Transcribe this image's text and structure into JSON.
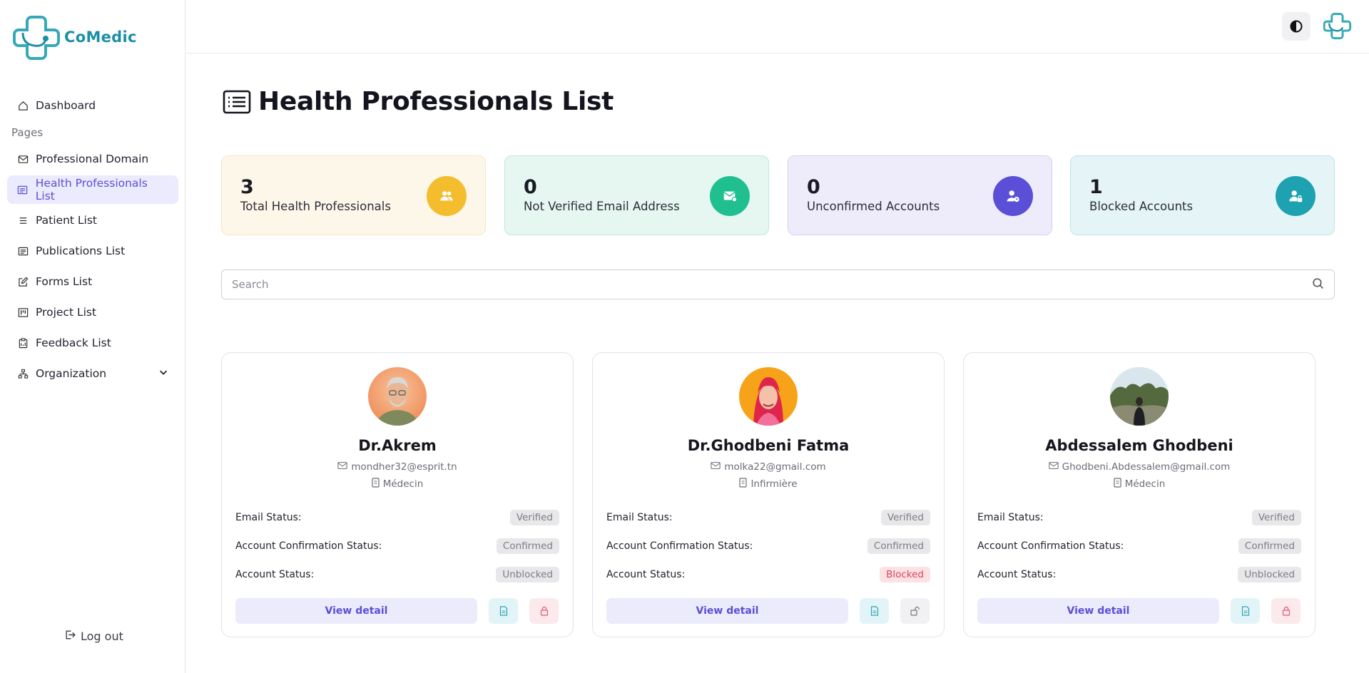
{
  "app": {
    "name": "CoMedic"
  },
  "sidebar": {
    "items": [
      {
        "label": "Dashboard",
        "icon": "home-icon"
      },
      {
        "label": "Professional Domain",
        "icon": "mail-icon"
      },
      {
        "label": "Health Professionals List",
        "icon": "list-icon"
      },
      {
        "label": "Patient List",
        "icon": "lines-icon"
      },
      {
        "label": "Publications List",
        "icon": "list-icon"
      },
      {
        "label": "Forms List",
        "icon": "edit-icon"
      },
      {
        "label": "Project List",
        "icon": "kanban-icon"
      },
      {
        "label": "Feedback List",
        "icon": "clipboard-icon"
      },
      {
        "label": "Organization",
        "icon": "organization-icon"
      }
    ],
    "section_label": "Pages",
    "active_item": "Health Professionals List",
    "logout_label": "Log out"
  },
  "header": {
    "theme_toggle_icon": "contrast-icon"
  },
  "page": {
    "title": "Health Professionals List"
  },
  "stats": [
    {
      "value": "3",
      "label": "Total Health Professionals",
      "bg": "#fdf7e9",
      "border": "#f6e7c3",
      "accent": "#f4bd2e"
    },
    {
      "value": "0",
      "label": "Not Verified Email Address",
      "bg": "#e6f7f2",
      "border": "#bfe8dc",
      "accent": "#1fbf8f"
    },
    {
      "value": "0",
      "label": "Unconfirmed Accounts",
      "bg": "#eeecfb",
      "border": "#d3cff4",
      "accent": "#5a4fd6"
    },
    {
      "value": "1",
      "label": "Blocked Accounts",
      "bg": "#e5f5f7",
      "border": "#bfe4ea",
      "accent": "#1ea1b1"
    }
  ],
  "search": {
    "placeholder": "Search"
  },
  "labels": {
    "email_status": "Email Status:",
    "account_confirmation_status": "Account Confirmation Status:",
    "account_status": "Account Status:",
    "view_detail": "View detail"
  },
  "professionals": [
    {
      "name": "Dr.Akrem",
      "email": "mondher32@esprit.tn",
      "role": "Médecin",
      "email_status": "Verified",
      "confirmation_status": "Confirmed",
      "account_status": "Unblocked"
    },
    {
      "name": "Dr.Ghodbeni Fatma",
      "email": "molka22@gmail.com",
      "role": "Infirmière",
      "email_status": "Verified",
      "confirmation_status": "Confirmed",
      "account_status": "Blocked"
    },
    {
      "name": "Abdessalem Ghodbeni",
      "email": "Ghodbeni.Abdessalem@gmail.com",
      "role": "Médecin",
      "email_status": "Verified",
      "confirmation_status": "Confirmed",
      "account_status": "Unblocked"
    }
  ],
  "colors": {
    "primary": "#5a4fd6",
    "brand": "#1b8fa6",
    "danger": "#d6455b"
  }
}
